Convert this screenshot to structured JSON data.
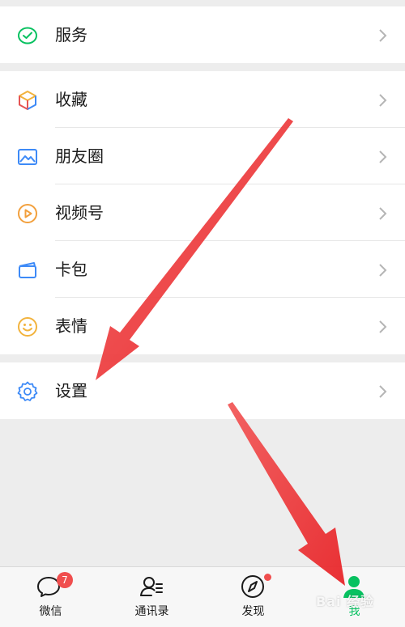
{
  "menu": {
    "services": {
      "label": "服务",
      "icon": "service-icon"
    },
    "items": [
      {
        "label": "收藏",
        "icon": "favorites-icon"
      },
      {
        "label": "朋友圈",
        "icon": "moments-icon"
      },
      {
        "label": "视频号",
        "icon": "channels-icon"
      },
      {
        "label": "卡包",
        "icon": "card-package-icon"
      },
      {
        "label": "表情",
        "icon": "sticker-icon"
      }
    ],
    "settings": {
      "label": "设置",
      "icon": "gear-icon"
    }
  },
  "tabbar": {
    "tabs": [
      {
        "label": "微信",
        "icon": "chat-icon",
        "badge": "7"
      },
      {
        "label": "通讯录",
        "icon": "contacts-icon"
      },
      {
        "label": "发现",
        "icon": "discover-icon",
        "dot": true
      },
      {
        "label": "我",
        "icon": "me-icon",
        "active": true
      }
    ]
  },
  "watermark": "Bai 经验",
  "colors": {
    "accent": "#07c160",
    "badge": "#f04e4e",
    "arrow": "#e8262a",
    "background": "#ededed"
  }
}
